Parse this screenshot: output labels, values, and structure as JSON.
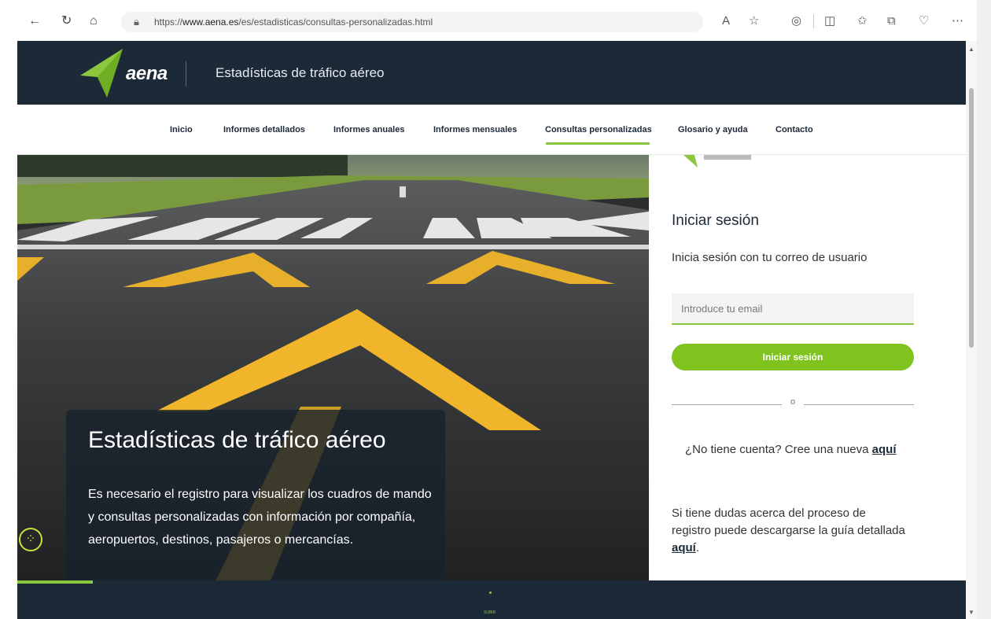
{
  "browser": {
    "url_prefix": "https://",
    "url_host": "www.aena.es",
    "url_path": "/es/estadisticas/consultas-personalizadas.html"
  },
  "header": {
    "logo_text": "aena",
    "title": "Estadísticas de tráfico aéreo"
  },
  "nav": {
    "items": [
      {
        "label": "Inicio"
      },
      {
        "label": "Informes detallados"
      },
      {
        "label": "Informes anuales"
      },
      {
        "label": "Informes mensuales"
      },
      {
        "label": "Consultas personalizadas"
      },
      {
        "label": "Glosario y ayuda"
      },
      {
        "label": "Contacto"
      }
    ],
    "active": "Consultas personalizadas"
  },
  "hero": {
    "title": "Estadísticas de tráfico aéreo",
    "text": "Es necesario el registro para visualizar los cuadros de mando y consultas personalizadas con información por compañía, aeropuertos, destinos, pasajeros o mercancías."
  },
  "login": {
    "title": "Iniciar sesión",
    "subtitle": "Inicia sesión con tu correo de usuario",
    "email_placeholder": "Introduce tu email",
    "button_label": "Iniciar sesión",
    "divider_text": "o",
    "no_account_text": "¿No tiene cuenta? Cree una nueva ",
    "no_account_link": "aquí",
    "doubts_text": "Si tiene dudas acerca del proceso de registro puede descargarse la guía detallada ",
    "doubts_link": "aquí",
    "doubts_end": "."
  },
  "footer": {
    "small_text": "SUBIR"
  },
  "colors": {
    "brand_dark": "#1c2a38",
    "brand_green": "#8cc63f",
    "button_green": "#80c31e"
  }
}
